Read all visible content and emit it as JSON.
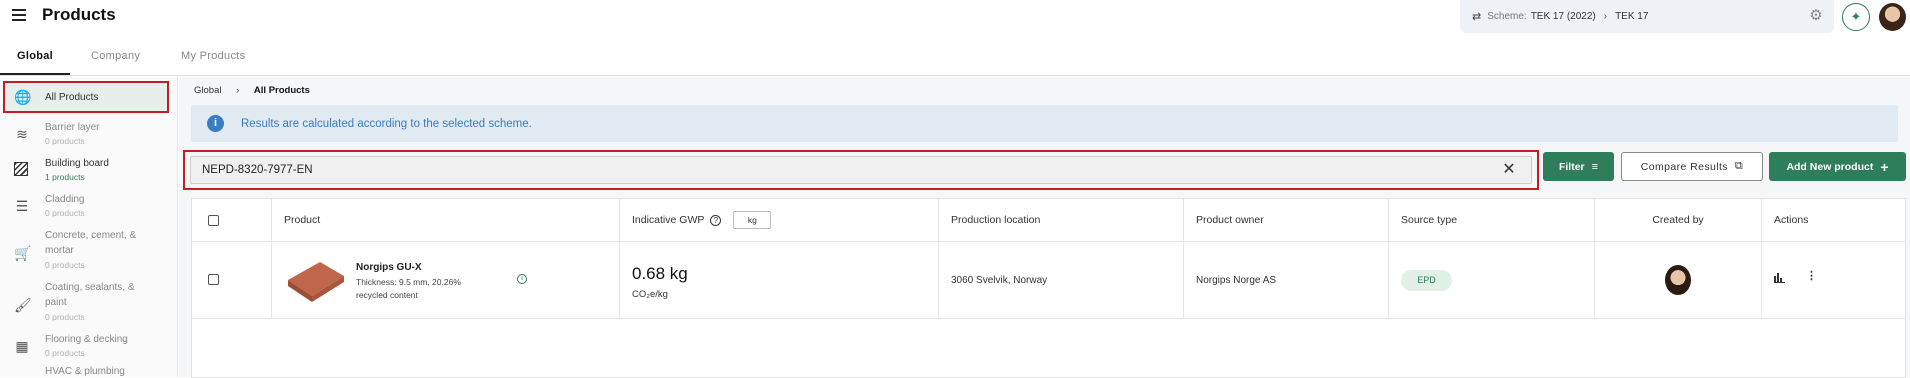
{
  "header": {
    "title": "Products",
    "scheme_label": "Scheme:",
    "scheme_value": "TEK 17 (2022)",
    "scheme_sub": "TEK 17"
  },
  "tabs": [
    {
      "label": "Global"
    },
    {
      "label": "Company"
    },
    {
      "label": "My Products"
    }
  ],
  "sidebar": {
    "items": [
      {
        "label": "All Products",
        "count": "",
        "icon": "globe-icon"
      },
      {
        "label": "Barrier layer",
        "count": "0 products",
        "icon": "layers-icon"
      },
      {
        "label": "Building board",
        "count": "1 products",
        "icon": "board-icon"
      },
      {
        "label": "Cladding",
        "count": "0 products",
        "icon": "cladding-icon"
      },
      {
        "label": "Concrete, cement, &",
        "label2": "mortar",
        "count": "0 products",
        "icon": "wheelbarrow-icon"
      },
      {
        "label": "Coating, sealants, &",
        "label2": "paint",
        "count": "0 products",
        "icon": "paint-roller-icon"
      },
      {
        "label": "Flooring & decking",
        "count": "0 products",
        "icon": "flooring-icon"
      },
      {
        "label": "HVAC & plumbing",
        "count": "",
        "icon": "pipe-icon"
      }
    ]
  },
  "breadcrumb": {
    "root": "Global",
    "current": "All Products"
  },
  "info_banner": "Results are calculated according to the selected scheme.",
  "search": {
    "value": "NEPD-8320-7977-EN"
  },
  "buttons": {
    "filter": "Filter",
    "compare": "Compare Results",
    "add": "Add New product"
  },
  "table": {
    "headers": {
      "product": "Product",
      "gwp": "Indicative GWP",
      "gwp_unit": "kg",
      "location": "Production location",
      "owner": "Product owner",
      "source": "Source type",
      "created_by": "Created by",
      "actions": "Actions"
    },
    "rows": [
      {
        "name": "Norgips GU-X",
        "desc_line1": "Thickness: 9.5 mm, 20.26%",
        "desc_line2": "recycled content",
        "gwp_value": "0.68 kg",
        "gwp_unit": "CO₂e/kg",
        "location": "3060 Svelvik, Norway",
        "owner": "Norgips Norge AS",
        "source": "EPD"
      }
    ]
  },
  "colors": {
    "accent": "#2e7d5b",
    "info": "#3c7dbf",
    "highlight": "#c41e25"
  }
}
